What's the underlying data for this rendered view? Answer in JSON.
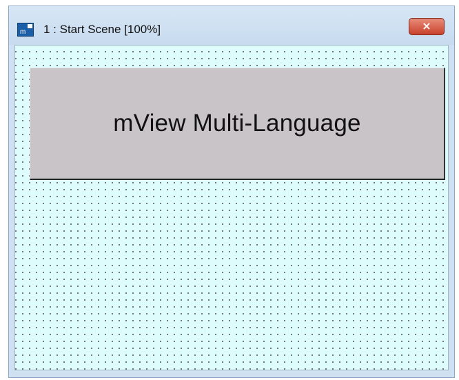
{
  "window": {
    "title": "1 : Start Scene [100%]",
    "icon": "mview-app-icon",
    "icon_text": "m",
    "close_icon": "×"
  },
  "scene": {
    "button_label": "mView Multi-Language"
  },
  "colors": {
    "canvas": "#dffcfc",
    "button_face": "#c8c4c8",
    "close_button": "#c9412a"
  }
}
